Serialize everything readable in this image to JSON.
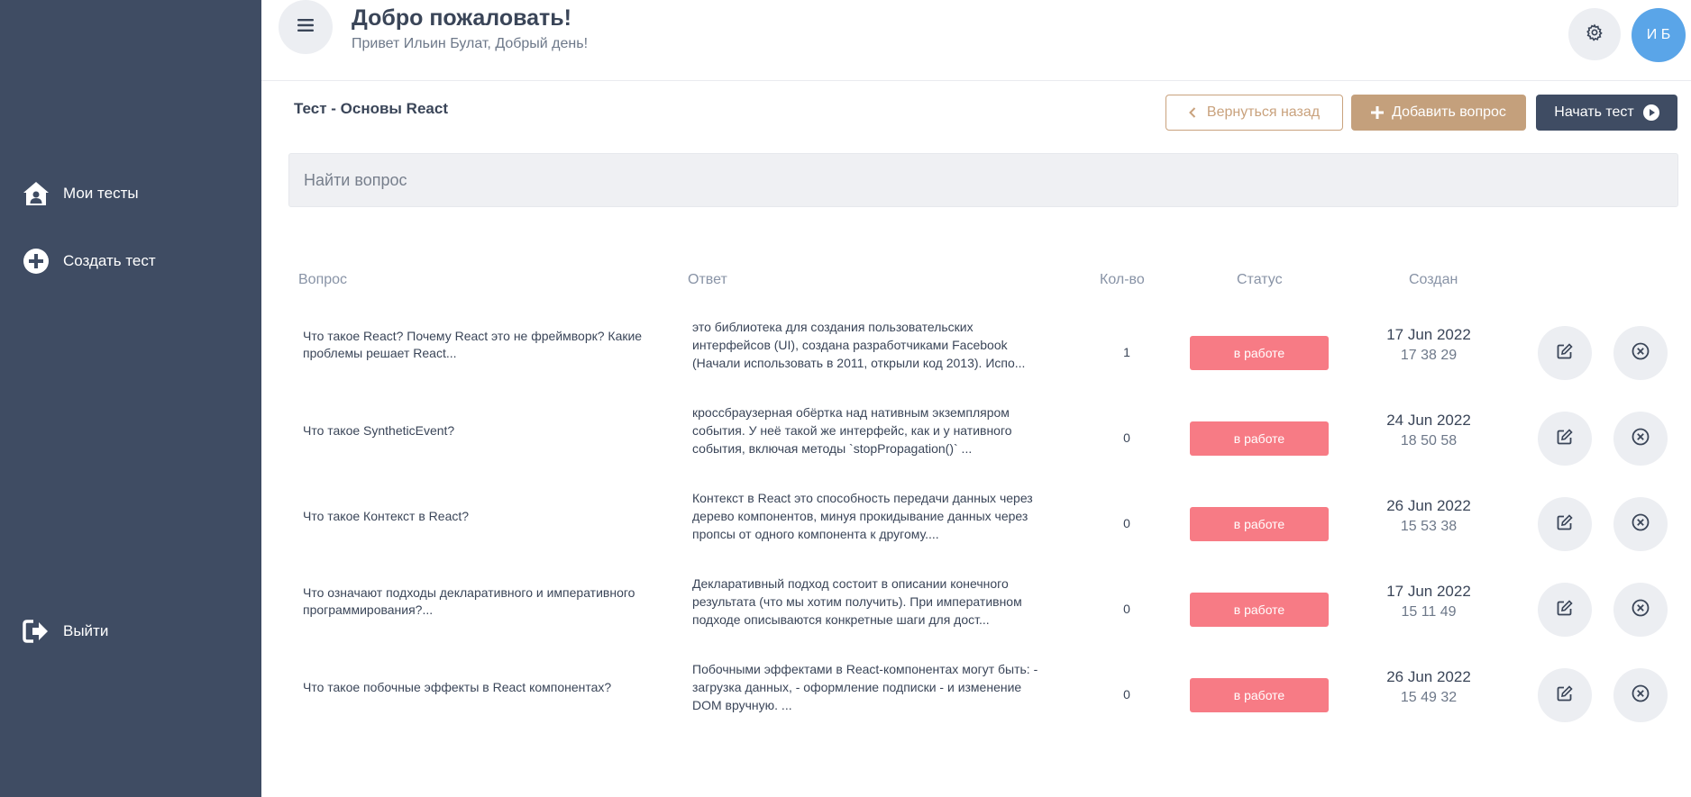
{
  "sidebar": {
    "items": [
      {
        "label": "Мои тесты",
        "icon": "house-user-icon"
      },
      {
        "label": "Создать тест",
        "icon": "plus-circle-icon"
      }
    ],
    "logout_label": "Выйти"
  },
  "header": {
    "title": "Добро пожаловать!",
    "subtitle": "Привет Ильин Булат, Добрый день!",
    "avatar_initials": "И Б"
  },
  "test": {
    "title": "Тест - Основы React"
  },
  "toolbar": {
    "back_label": "Вернуться назад",
    "add_label": "Добавить вопрос",
    "start_label": "Начать тест"
  },
  "search": {
    "placeholder": "Найти вопрос",
    "value": ""
  },
  "table": {
    "headers": {
      "question": "Вопрос",
      "answer": "Ответ",
      "count": "Кол-во",
      "status": "Статус",
      "created": "Создан"
    },
    "rows": [
      {
        "question": "Что такое React? Почему React это не фреймворк? Какие проблемы решает React...",
        "answer": "это библиотека для создания пользовательских интерфейсов (UI), создана разработчиками Facebook (Начали использовать в 2011, открыли код 2013). Испо...",
        "count": "1",
        "status": "в работе",
        "date": "17 Jun 2022",
        "time": "17 38 29"
      },
      {
        "question": "Что такое SyntheticEvent?",
        "answer": "кроссбраузерная обёртка над нативным экземпляром события. У неё такой же интерфейс, как и у нативного события, включая методы `stopPropagation()` ...",
        "count": "0",
        "status": "в работе",
        "date": "24 Jun 2022",
        "time": "18 50 58"
      },
      {
        "question": "Что такое Контекст в React?",
        "answer": "Контекст в React это способность передачи данных через дерево компонентов, минуя прокидывание данных через пропсы от одного компонента к другому....",
        "count": "0",
        "status": "в работе",
        "date": "26 Jun 2022",
        "time": "15 53 38"
      },
      {
        "question": "Что означают подходы декларативного и императивного программирования?...",
        "answer": "Декларативный подход состоит в описании конечного результата (что мы хотим получить). При императивном подходе описываются конкретные шаги для дост...",
        "count": "0",
        "status": "в работе",
        "date": "17 Jun 2022",
        "time": "15 11 49"
      },
      {
        "question": "Что такое побочные эффекты в React компонентах?",
        "answer": "Побочными эффектами в React-компонентах могут быть: - загрузка данных, - оформление подписки - и изменение DOM вручную. ...",
        "count": "0",
        "status": "в работе",
        "date": "26 Jun 2022",
        "time": "15 49 32"
      }
    ]
  },
  "colors": {
    "sidebar_bg": "#3f4c63",
    "accent_tan": "#c4a07c",
    "status_red": "#f77b85",
    "avatar_blue": "#5aa5e8"
  }
}
